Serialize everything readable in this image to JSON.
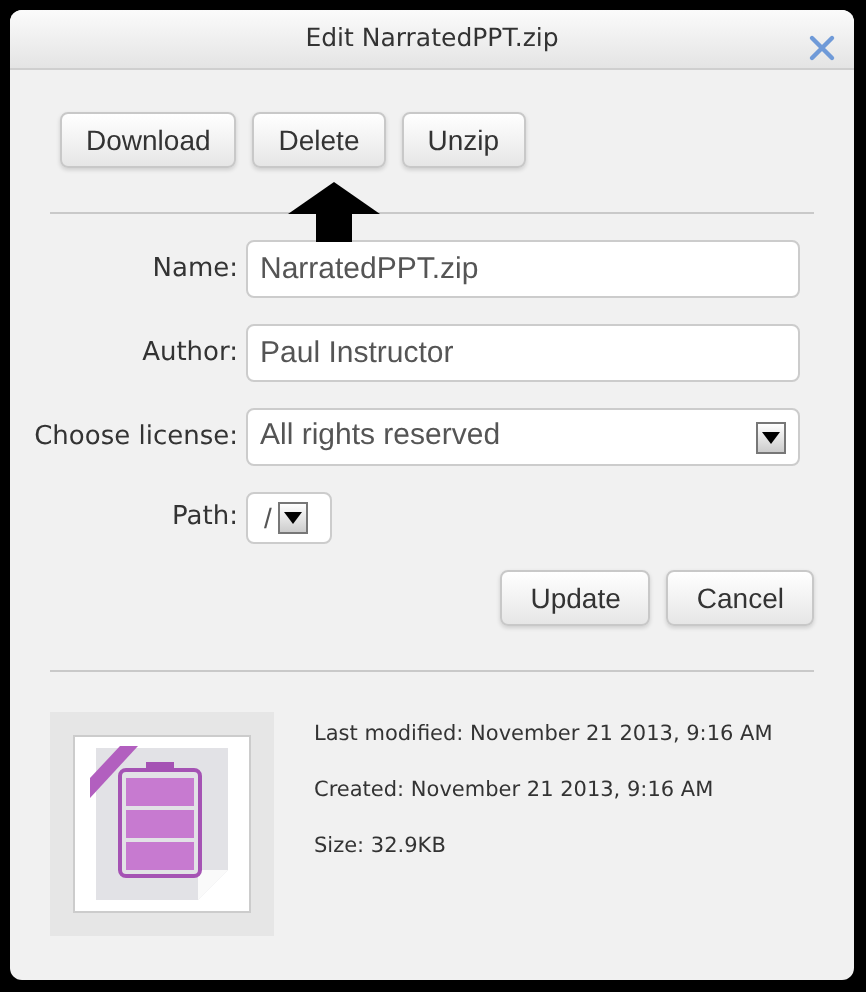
{
  "window": {
    "title": "Edit NarratedPPT.zip"
  },
  "actions": [
    "Download",
    "Delete",
    "Unzip"
  ],
  "fields": [
    {
      "label": "Name:",
      "kind": "text",
      "value": "NarratedPPT.zip"
    },
    {
      "label": "Author:",
      "kind": "text",
      "value": "Paul Instructor"
    },
    {
      "label": "Choose license:",
      "kind": "select",
      "value": "All rights reserved"
    },
    {
      "label": "Path:",
      "kind": "path",
      "value": "/"
    }
  ],
  "form_buttons": [
    "Update",
    "Cancel"
  ],
  "file_info": [
    "Last modified: November 21 2013, 9:16 AM",
    "Created: November 21 2013, 9:16 AM",
    "Size: 32.9KB"
  ]
}
